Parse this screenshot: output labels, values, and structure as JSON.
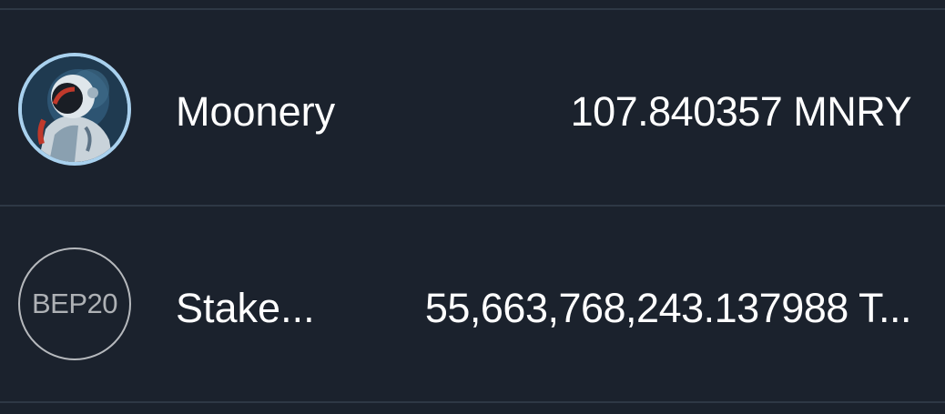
{
  "tokens": [
    {
      "name": "Moonery",
      "amount": "107.840357 MNRY",
      "icon": "astronaut-avatar-icon"
    },
    {
      "name": "Stake...",
      "amount": "55,663,768,243.137988 T...",
      "icon": "bep20-token-icon",
      "icon_label": "BEP20"
    }
  ],
  "colors": {
    "background": "#1b222d",
    "divider": "#2e3845",
    "text": "#ffffff",
    "avatar_ring": "#a9d1ee"
  }
}
